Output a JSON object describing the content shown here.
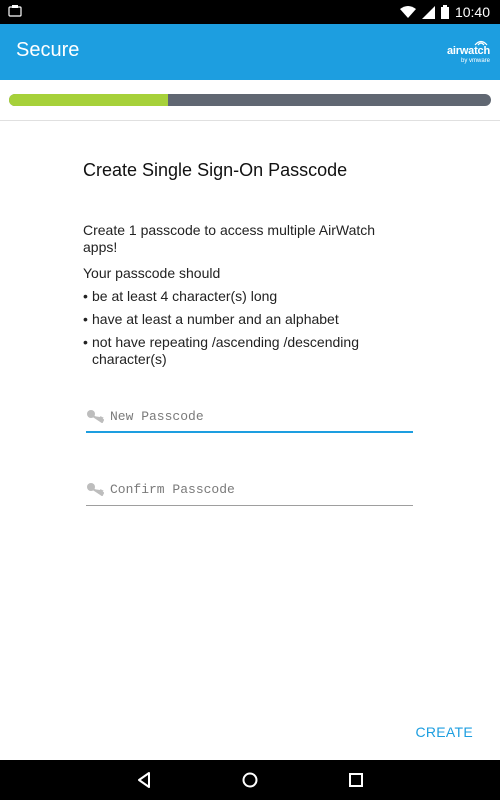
{
  "status_bar": {
    "time": "10:40"
  },
  "app_bar": {
    "title": "Secure",
    "brand_main": "airwatch",
    "brand_sub": "by vmware"
  },
  "progress": {
    "value": 0.33,
    "fill_color": "#a6d13a",
    "track_color": "#606772"
  },
  "content": {
    "heading": "Create Single Sign-On Passcode",
    "description": "Create 1 passcode to access multiple AirWatch apps!",
    "requirements_title": "Your passcode should",
    "requirements": [
      "be at least 4 character(s) long",
      "have at least a number and an alphabet",
      "not have repeating /ascending /descending character(s)"
    ]
  },
  "form": {
    "new_passcode_placeholder": "New Passcode",
    "confirm_passcode_placeholder": "Confirm Passcode"
  },
  "actions": {
    "create_label": "CREATE"
  },
  "colors": {
    "accent": "#1d9ee0"
  }
}
